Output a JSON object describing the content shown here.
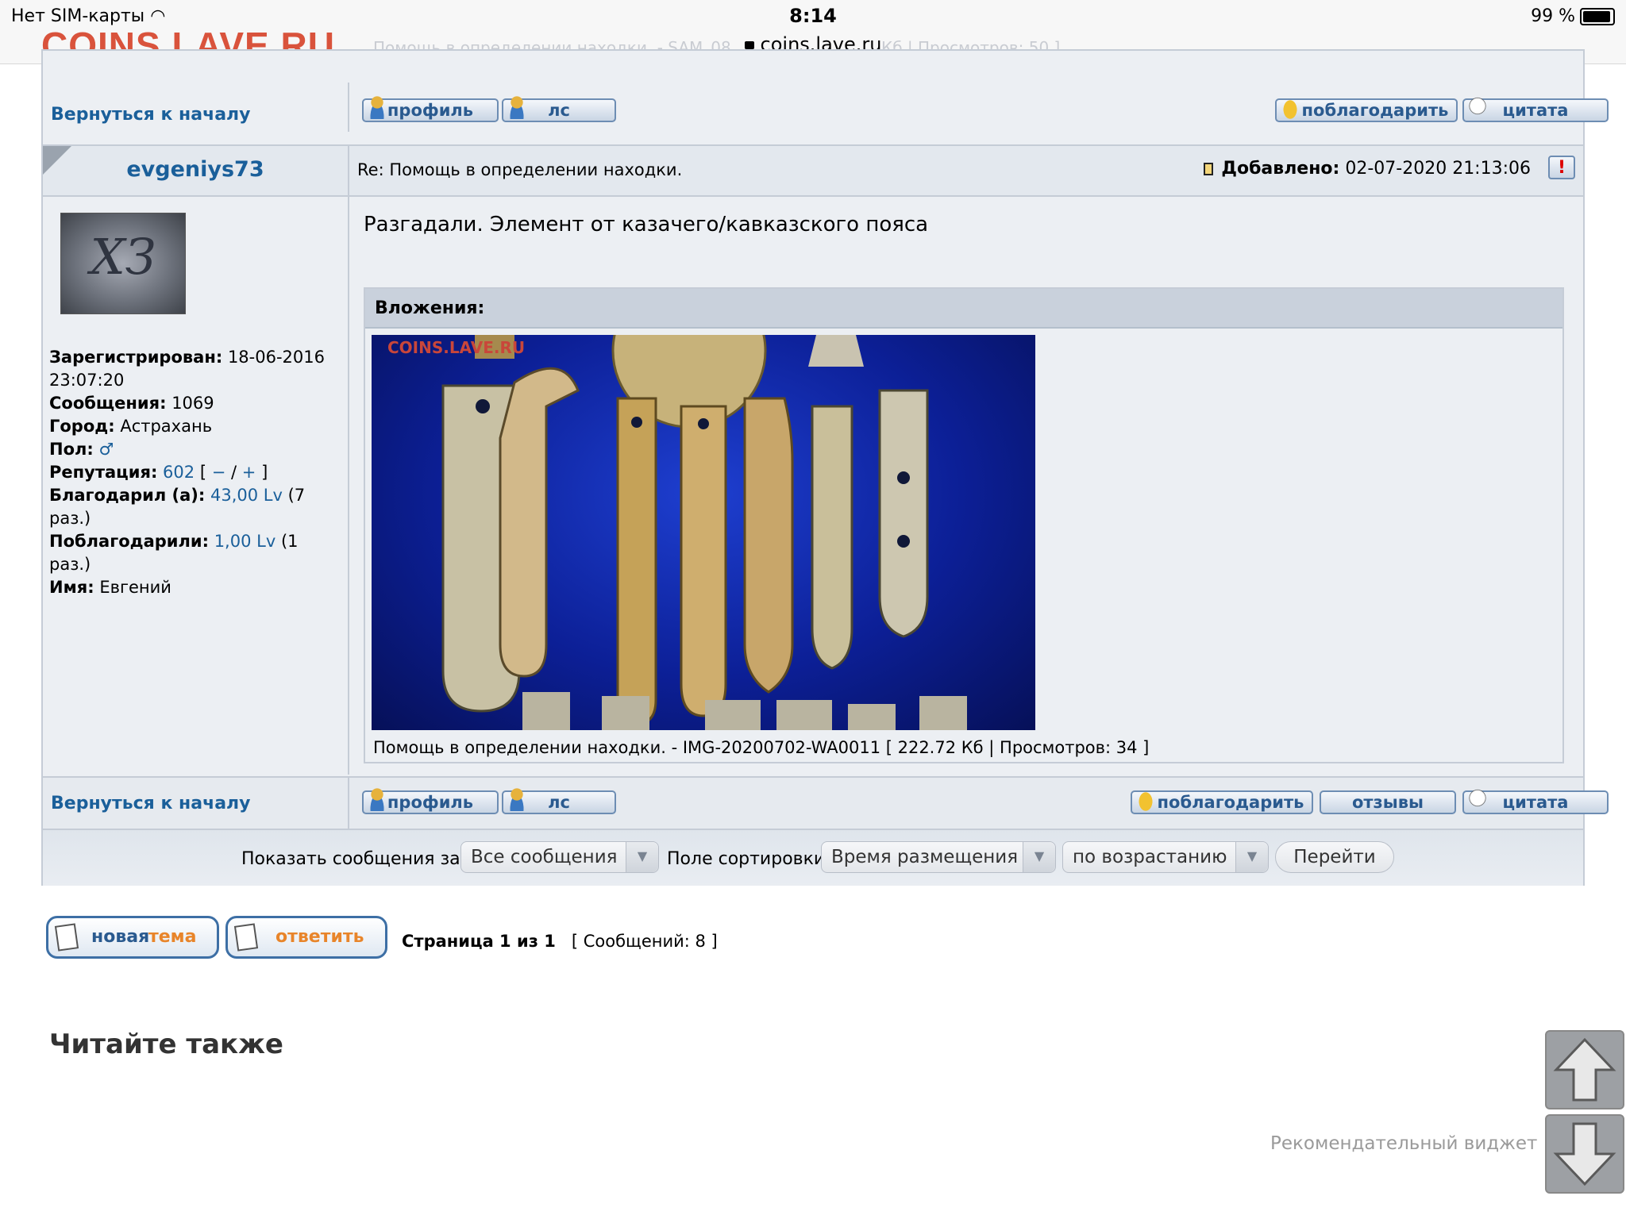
{
  "status_bar": {
    "carrier": "Нет SIM-карты",
    "time": "8:14",
    "url": "coins.lave.ru",
    "battery": "99 %"
  },
  "site_logo": "COINS.LAVE.RU",
  "ghost_text": {
    "left": "Помощь в определении находки. - SAM_08",
    "right": "Кб | Просмотров: 50 ]"
  },
  "top_bar": {
    "back_link": "Вернуться к началу",
    "buttons": {
      "profile": "профиль",
      "pm": "лс",
      "thank": "поблагодарить",
      "quote": "цитата"
    }
  },
  "post": {
    "author": "evgeniys73",
    "avatar_text": "ХЗ",
    "title": "Re: Помощь в определении находки.",
    "added_label": "Добавлено:",
    "added_value": "02-07-2020 21:13:06",
    "report_icon": "!",
    "text": "Разгадали. Элемент от казачего/кавказского пояса",
    "attachments_label": "Вложения:",
    "photo_watermark": "COINS.LAVE.RU",
    "caption": "Помощь в определении находки. - IMG-20200702-WA0011 [ 222.72 Кб | Просмотров: 34 ]",
    "profile": {
      "registered_label": "Зарегистрирован:",
      "registered_value": "18-06-2016 23:07:20",
      "messages_label": "Сообщения:",
      "messages_value": "1069",
      "city_label": "Город:",
      "city_value": "Астрахань",
      "gender_label": "Пол:",
      "gender_icon": "♂",
      "reputation_label": "Репутация:",
      "reputation_value": "602",
      "rep_open": "[",
      "rep_minus": "−",
      "rep_slash": "/",
      "rep_plus": "+",
      "rep_close": "]",
      "thanked_label": "Благодарил (а):",
      "thanked_value": "43,00 Lv",
      "thanked_count": "(7 раз.)",
      "got_thanks_label": "Поблагодарили:",
      "got_thanks_value": "1,00 Lv",
      "got_thanks_count": "(1 раз.)",
      "name_label": "Имя:",
      "name_value": "Евгений"
    }
  },
  "bottom_bar": {
    "back_link": "Вернуться к началу",
    "buttons": {
      "profile": "профиль",
      "pm": "лс",
      "thank": "поблагодарить",
      "reviews": "отзывы",
      "quote": "цитата"
    }
  },
  "filter": {
    "show_label": "Показать сообщения за:",
    "show_value": "Все сообщения",
    "sort_label": "Поле сортировки",
    "sort_value": "Время размещения",
    "order_value": "по возрастанию",
    "go": "Перейти"
  },
  "actions": {
    "new_topic_1": "новая",
    "new_topic_2": "тема",
    "reply": "ответить"
  },
  "pagination": {
    "page_text": "Страница 1 из 1",
    "messages_text": "[ Сообщений: 8 ]"
  },
  "read_also": "Читайте также",
  "widget_text": "Рекомендательный виджет РСЯ"
}
